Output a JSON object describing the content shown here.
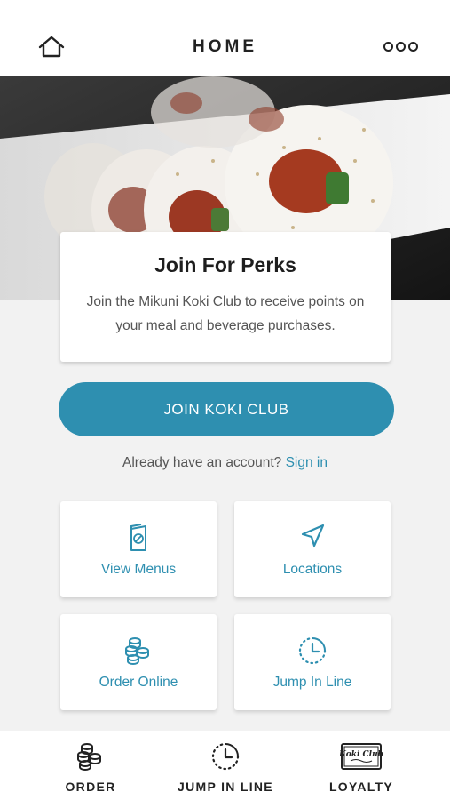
{
  "header": {
    "title": "HOME",
    "home_icon": "home-icon",
    "menu_icon": "more-dots-icon"
  },
  "hero": {
    "image": "sushi-roll-photo"
  },
  "perks": {
    "title": "Join For Perks",
    "text": "Join the Mikuni Koki Club to receive points on your meal and beverage purchases."
  },
  "join_button": "JOIN KOKI CLUB",
  "signin": {
    "prompt": "Already have an account?",
    "link": "Sign in"
  },
  "tiles": [
    {
      "label": "View Menus",
      "icon": "menu-book-icon"
    },
    {
      "label": "Locations",
      "icon": "navigation-arrow-icon"
    },
    {
      "label": "Order Online",
      "icon": "sushi-stack-icon"
    },
    {
      "label": "Jump In Line",
      "icon": "clock-icon"
    }
  ],
  "tabbar": [
    {
      "label": "ORDER",
      "icon": "sushi-stack-icon"
    },
    {
      "label": "JUMP IN LINE",
      "icon": "clock-icon"
    },
    {
      "label": "LOYALTY",
      "icon": "koki-club-card-icon",
      "logo_text": "Koki Club"
    }
  ],
  "colors": {
    "accent": "#2e8fb0",
    "background": "#f2f2f2",
    "text": "#222222"
  }
}
